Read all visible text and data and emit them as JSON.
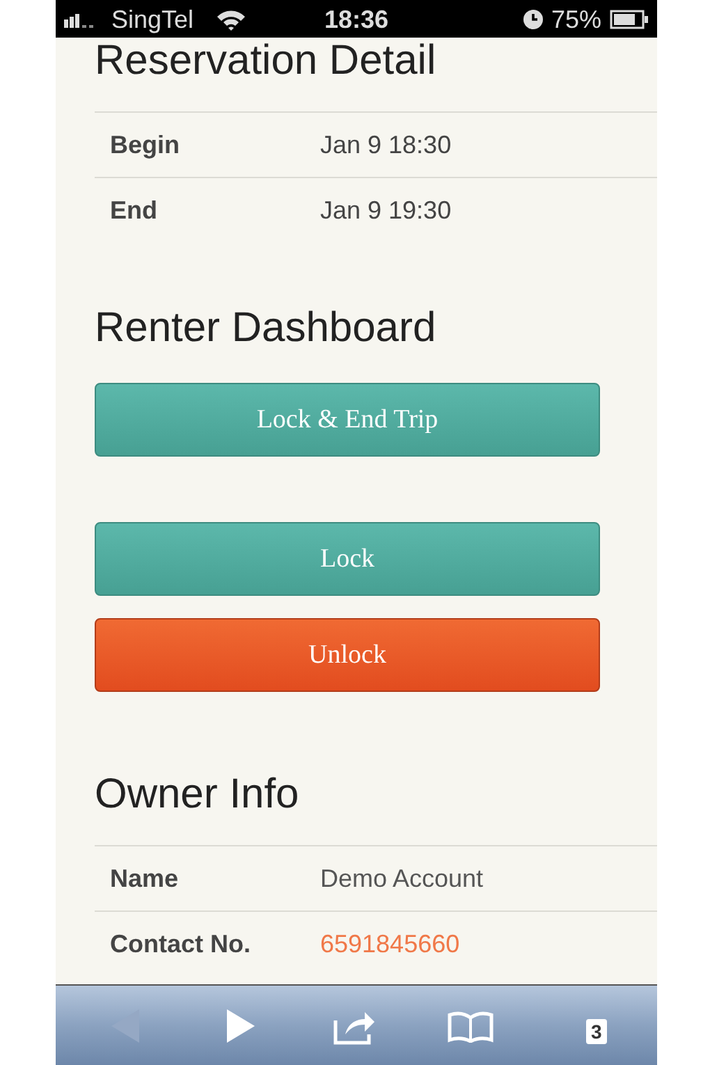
{
  "status_bar": {
    "carrier": "SingTel",
    "time": "18:36",
    "battery": "75%"
  },
  "reservation": {
    "title": "Reservation Detail",
    "rows": [
      {
        "label": "Begin",
        "value": "Jan 9 18:30",
        "kind": "text"
      },
      {
        "label": "End",
        "value": "Jan 9 19:30",
        "kind": "text"
      }
    ]
  },
  "dashboard": {
    "title": "Renter Dashboard",
    "button_groups": [
      [
        {
          "label": "Lock & End Trip",
          "kind": "primary"
        }
      ],
      [
        {
          "label": "Lock",
          "kind": "primary"
        },
        {
          "label": "Unlock",
          "kind": "danger"
        }
      ]
    ]
  },
  "owner": {
    "title": "Owner Info",
    "rows": [
      {
        "label": "Name",
        "value": "Demo Account",
        "kind": "text"
      },
      {
        "label": "Contact No.",
        "value": "6591845660",
        "kind": "link"
      }
    ]
  },
  "toolbar": {
    "items": [
      {
        "kind": "back",
        "disabled": true
      },
      {
        "kind": "forward",
        "disabled": false
      },
      {
        "kind": "share",
        "disabled": false
      },
      {
        "kind": "bookmarks",
        "disabled": false
      },
      {
        "kind": "tabs",
        "disabled": false,
        "count": "3"
      }
    ]
  }
}
